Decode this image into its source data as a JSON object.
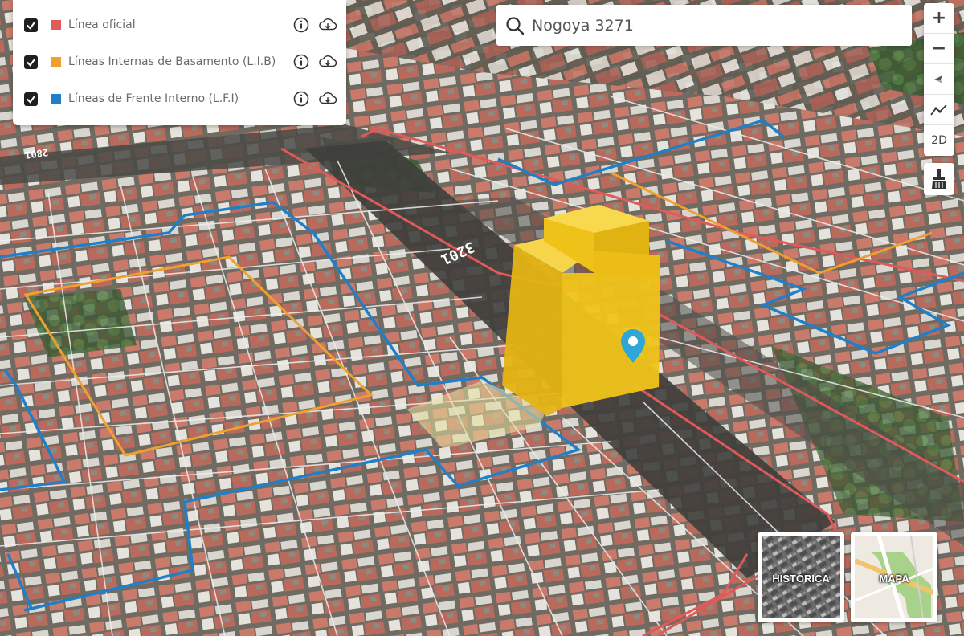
{
  "layers": [
    {
      "label": "Línea oficial",
      "color": "#e05a5a",
      "checked": true
    },
    {
      "label": "Líneas Internas de Basamento (L.I.B)",
      "color": "#f0a030",
      "checked": true
    },
    {
      "label": "Líneas de Frente Interno (L.F.I)",
      "color": "#1f7fc8",
      "checked": true
    }
  ],
  "layer_icons": {
    "info": "info-icon",
    "download": "cloud-download-icon"
  },
  "search": {
    "value": "Nogoya 3271",
    "placeholder": ""
  },
  "controls": {
    "zoom_in": "+",
    "zoom_out": "−",
    "mode_2d": "2D"
  },
  "map": {
    "street_number": "3201",
    "street_number_top_left": "2801"
  },
  "basemaps": [
    {
      "label": "HISTÓRICA"
    },
    {
      "label": "MAPA"
    }
  ],
  "colors": {
    "building": "#f0c419",
    "pin": "#2fa6d8",
    "official_line": "#e05a5a",
    "lib_line": "#f0a030",
    "lfi_line": "#1f7fc8"
  }
}
